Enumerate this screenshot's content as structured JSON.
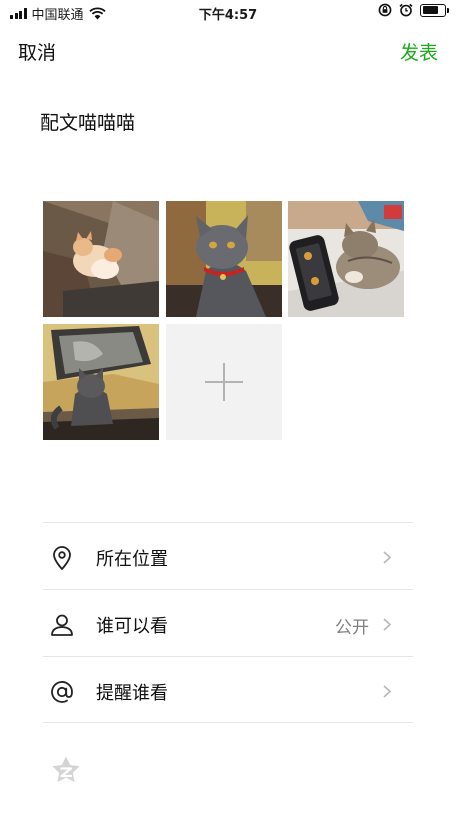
{
  "status_bar": {
    "carrier": "中国联通",
    "time": "下午4:57"
  },
  "nav": {
    "cancel_label": "取消",
    "publish_label": "发表",
    "accent_color": "#1aad19"
  },
  "post": {
    "caption": "配文喵喵喵"
  },
  "photos": [
    {
      "icon": "orange-white-cat-photo"
    },
    {
      "icon": "gray-cat-red-collar-photo"
    },
    {
      "icon": "tabby-cat-with-phone-photo"
    },
    {
      "icon": "gray-cat-on-desk-photo"
    }
  ],
  "add_photo": {
    "icon": "plus-icon"
  },
  "options": [
    {
      "icon": "location-pin-icon",
      "label": "所在位置",
      "value": ""
    },
    {
      "icon": "person-icon",
      "label": "谁可以看",
      "value": "公开"
    },
    {
      "icon": "at-sign-icon",
      "label": "提醒谁看",
      "value": ""
    }
  ],
  "footer": {
    "icon": "qzone-star-icon"
  }
}
